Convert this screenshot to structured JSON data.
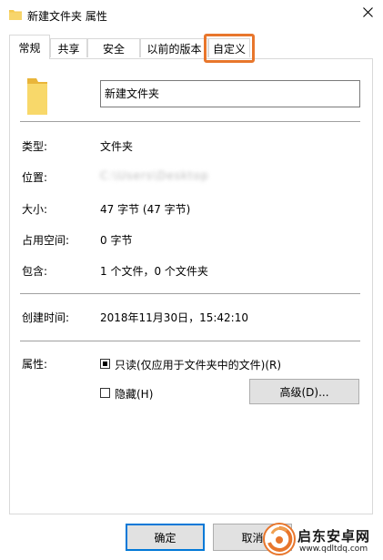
{
  "window": {
    "title": "新建文件夹 属性",
    "close_icon": "close-icon"
  },
  "tabs": [
    {
      "label": "常规",
      "active": true
    },
    {
      "label": "共享",
      "active": false
    },
    {
      "label": "安全",
      "active": false
    },
    {
      "label": "以前的版本",
      "active": false
    },
    {
      "label": "自定义",
      "active": false,
      "highlighted": true
    }
  ],
  "colors": {
    "highlight": "#e8762c",
    "folder": "#f4c94f",
    "primary_button_border": "#0078d7"
  },
  "general": {
    "folder_name": "新建文件夹",
    "type_label": "类型:",
    "type_value": "文件夹",
    "location_label": "位置:",
    "location_value": "C:\\Users\\Desktop",
    "size_label": "大小:",
    "size_value": "47 字节 (47 字节)",
    "disk_size_label": "占用空间:",
    "disk_size_value": "0 字节",
    "contains_label": "包含:",
    "contains_value": "1 个文件，0 个文件夹",
    "created_label": "创建时间:",
    "created_value": "2018年11月30日，15:42:10",
    "attributes_label": "属性:",
    "readonly_label": "只读(仅应用于文件夹中的文件)(R)",
    "readonly_state": "indeterminate",
    "hidden_label": "隐藏(H)",
    "hidden_checked": false,
    "advanced_button": "高级(D)..."
  },
  "footer": {
    "ok_button": "确定",
    "cancel_button": "取消"
  },
  "watermark": {
    "line1": "启东安卓网",
    "line2": "www.qdltdq.com"
  }
}
